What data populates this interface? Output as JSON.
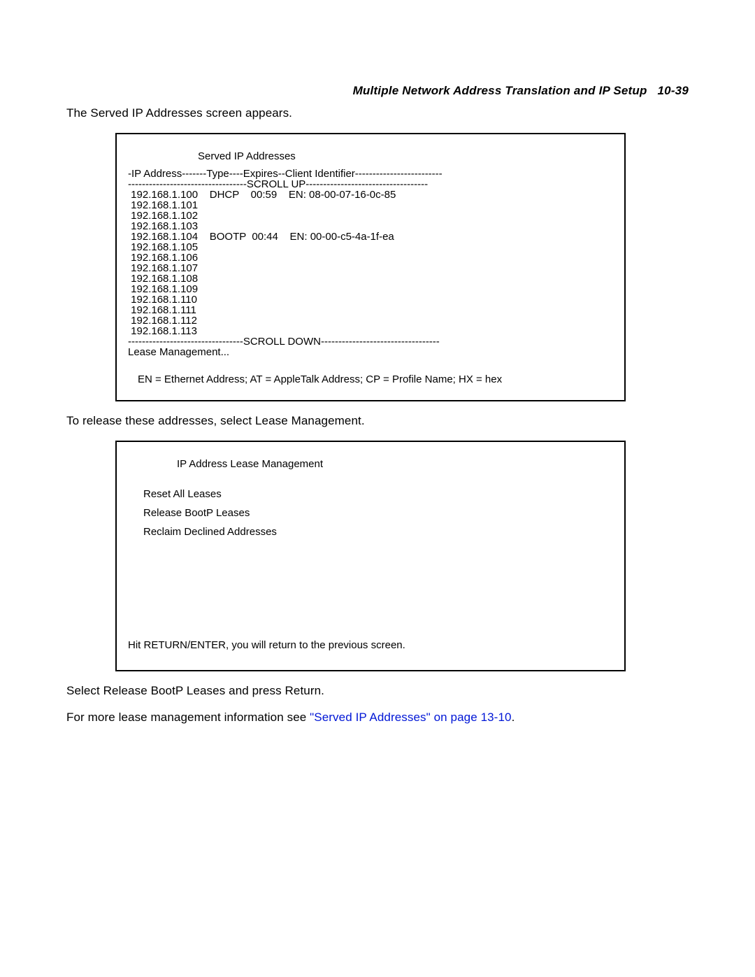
{
  "header": {
    "title": "Multiple Network Address Translation and IP Setup",
    "pageno": "10-39"
  },
  "para1": "The Served IP Addresses screen appears.",
  "screen1": {
    "title": "Served IP Addresses",
    "header_line": "-IP Address-------Type----Expires--Client Identifier-------------------------",
    "scroll_up": "----------------------------------SCROLL UP-----------------------------------",
    "rows": [
      " 192.168.1.100    DHCP    00:59    EN: 08-00-07-16-0c-85",
      " 192.168.1.101",
      " 192.168.1.102",
      " 192.168.1.103",
      " 192.168.1.104    BOOTP  00:44    EN: 00-00-c5-4a-1f-ea",
      " 192.168.1.105",
      " 192.168.1.106",
      " 192.168.1.107",
      " 192.168.1.108",
      " 192.168.1.109",
      " 192.168.1.110",
      " 192.168.1.111",
      " 192.168.1.112",
      " 192.168.1.113"
    ],
    "scroll_down": "---------------------------------SCROLL DOWN----------------------------------",
    "lease_mgmt": "Lease Management...",
    "legend": "EN = Ethernet Address; AT = AppleTalk Address; CP = Profile Name; HX = hex"
  },
  "para2": "To release these addresses, select Lease Management.",
  "screen2": {
    "title": "IP Address Lease Management",
    "items": [
      "Reset All Leases",
      "Release BootP Leases",
      "Reclaim Declined Addresses"
    ],
    "hint": "Hit RETURN/ENTER, you will return to the previous screen."
  },
  "para3": "Select Release BootP Leases and press Return.",
  "para4a": "For more lease management information see ",
  "para4link": "\"Served IP Addresses\" on page 13-10",
  "para4b": "."
}
